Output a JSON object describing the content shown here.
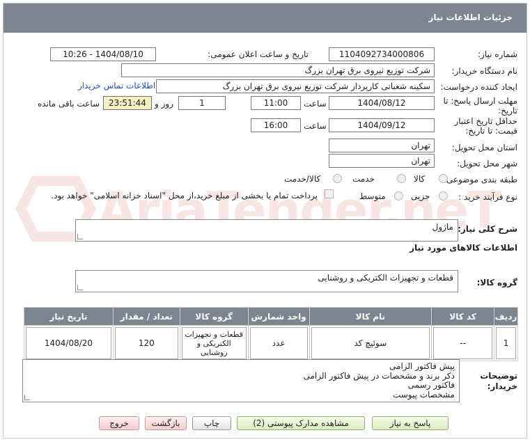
{
  "header": {
    "title": "جزئیات اطلاعات نیاز"
  },
  "fields": {
    "need_number_label": "شماره نیاز:",
    "need_number": "1104092734000806",
    "announce_label": "تاریخ و ساعت اعلان عمومی:",
    "announce_value": "1404/08/10 - 10:26",
    "buyer_org_label": "نام دستگاه خریدار:",
    "buyer_org": "شرکت توزیع نیروی برق تهران بزرگ",
    "creator_label": "ایجاد کننده درخواست:",
    "creator": "سکینه شعبانی کارپرداز شرکت توزیع نیروی برق تهران بزرگ",
    "contact_link": "اطلاعات تماس خریدار",
    "reply_deadline_label_1": "مهلت ارسال پاسخ: تا",
    "reply_deadline_label_2": "تاریخ:",
    "reply_date": "1404/08/12",
    "time_label": "ساعت",
    "reply_time": "11:00",
    "days_value": "1",
    "days_label": "روز و",
    "remaining_time": "23:51:44",
    "remaining_label": "ساعت باقی مانده",
    "price_valid_label_1": "حداقل تاریخ اعتبار",
    "price_valid_label_2": "قیمت: تا تاریخ:",
    "price_valid_date": "1404/09/12",
    "price_valid_time": "16:00",
    "province_label": "استان محل تحویل:",
    "province": "تهران",
    "city_label": "شهر محل تحویل:",
    "city": "تهران",
    "category_label": "طبقه بندی موضوعی:",
    "category_options": [
      "کالا",
      "خدمت",
      "کالا/خدمت"
    ],
    "process_label": "نوع فرآیند خرید :",
    "process_options": [
      "جزیی",
      "متوسط"
    ],
    "payment_note": "پرداخت تمام یا بخشی از مبلغ خرید،از محل \"اسناد خزانه اسلامی\" خواهد بود."
  },
  "description": {
    "label": "شرح کلی نیاز:",
    "value": "ماژول"
  },
  "goods_info": {
    "section_title": "اطلاعات کالاهای مورد نیاز",
    "group_label": "گروه کالا:",
    "group_value": "قطعات و تجهیزات الکتریکی و روشنایی"
  },
  "table": {
    "headers": [
      "ردیف",
      "کد کالا",
      "نام کالا",
      "واحد شمارش",
      "گروه کالا",
      "تعداد / مقدار",
      "تاریخ نیاز"
    ],
    "rows": [
      [
        "1",
        "--",
        "سوئیچ کد",
        "عدد",
        "قطعات و تجهیزات الکتریکی و روشنایی",
        "120",
        "1404/08/20"
      ]
    ]
  },
  "buyer_notes": {
    "label_1": "توضیحات",
    "label_2": "خریدار:",
    "lines": [
      "پیش فاکتور الزامی",
      "ذکر برند و مشخصات در پیش فاکتور الزامی",
      "فاکتور رسمی",
      "مشخصات پیوست"
    ]
  },
  "buttons": {
    "reply": "پاسخ به نیاز",
    "docs": "مشاهده مدارک پیوستی (2)",
    "print": "چاپ",
    "back": "بازگشت",
    "exit": "خروج"
  },
  "watermark": {
    "text": "AriaTender.neT"
  },
  "colors": {
    "header": "#7d8590",
    "accent_link": "#1a4fd0",
    "remaining_bg": "#f5f0c4"
  }
}
